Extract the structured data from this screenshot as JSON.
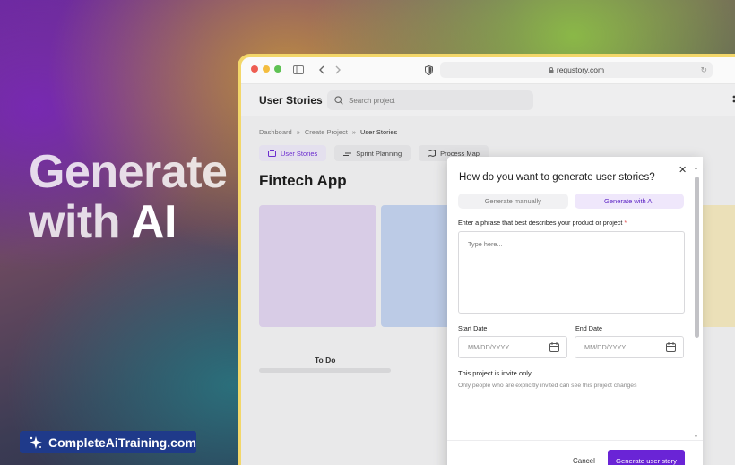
{
  "hero": {
    "line1": "Generate",
    "line2_prefix": "with ",
    "line2_ai": "AI"
  },
  "brand": {
    "name": "CompleteAiTraining.com",
    "bg_color": "#1f3a8a"
  },
  "browser": {
    "url": "requstory.com",
    "frame_color": "#f3d76a"
  },
  "app": {
    "title": "User Stories",
    "search_placeholder": "Search project",
    "breadcrumb": [
      "Dashboard",
      "Create Project",
      "User Stories"
    ],
    "tabs": [
      {
        "label": "User Stories",
        "icon": "stories-icon",
        "active": true
      },
      {
        "label": "Sprint Planning",
        "icon": "sprint-icon",
        "active": false
      },
      {
        "label": "Process Map",
        "icon": "map-icon",
        "active": false
      }
    ],
    "project_title": "Fintech App",
    "column_label": "To Do",
    "card_colors": [
      "#d8cce6",
      "#bccbe6",
      "#ebe0b8"
    ]
  },
  "modal": {
    "title": "How do you want to generate user stories?",
    "options": [
      {
        "label": "Generate manually",
        "selected": false
      },
      {
        "label": "Generate with AI",
        "selected": true
      }
    ],
    "phrase_label": "Enter a phrase that best describes your product or project",
    "required_mark": "*",
    "phrase_placeholder": "Type here...",
    "start_date_label": "Start Date",
    "end_date_label": "End Date",
    "date_placeholder": "MM/DD/YYYY",
    "invite_title": "This project is invite only",
    "invite_sub": "Only people who are explicitly invited can see this project changes",
    "cancel_label": "Cancel",
    "submit_label": "Generate user story",
    "accent_color": "#6a24d6"
  }
}
